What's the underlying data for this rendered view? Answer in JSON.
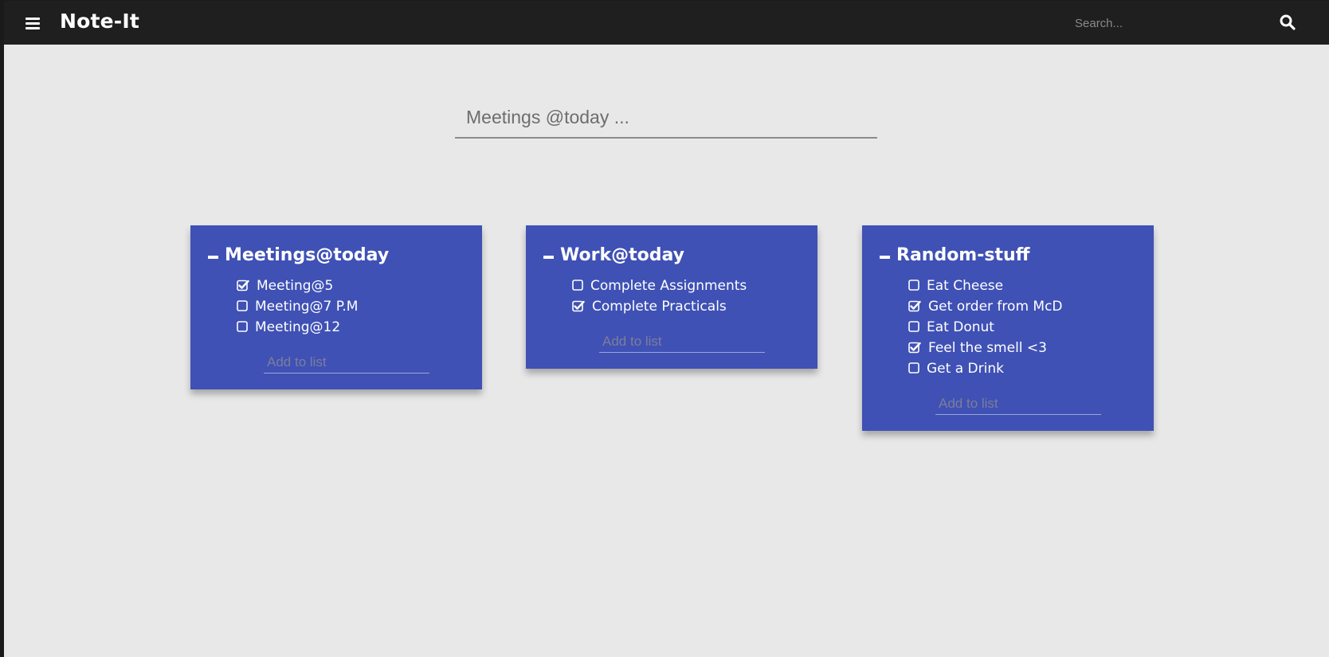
{
  "app": {
    "title": "Note-It"
  },
  "header": {
    "menu_icon": "hamburger-menu-icon",
    "search_placeholder": "Search...",
    "search_icon": "search-icon"
  },
  "new_list": {
    "placeholder": "Meetings @today ..."
  },
  "colors": {
    "card": "#3f51b5",
    "topbar": "#1f1f1f",
    "background": "#e8e8e8"
  },
  "cards": [
    {
      "title": "Meetings@today",
      "add_placeholder": "Add to list",
      "items": [
        {
          "label": "Meeting@5",
          "checked": true
        },
        {
          "label": "Meeting@7 P.M",
          "checked": false
        },
        {
          "label": "Meeting@12",
          "checked": false
        }
      ]
    },
    {
      "title": "Work@today",
      "add_placeholder": "Add to list",
      "items": [
        {
          "label": "Complete Assignments",
          "checked": false
        },
        {
          "label": "Complete Practicals",
          "checked": true
        }
      ]
    },
    {
      "title": "Random-stuff",
      "add_placeholder": "Add to list",
      "items": [
        {
          "label": "Eat Cheese",
          "checked": false
        },
        {
          "label": "Get order from McD",
          "checked": true
        },
        {
          "label": "Eat Donut",
          "checked": false
        },
        {
          "label": "Feel the smell <3",
          "checked": true
        },
        {
          "label": "Get a Drink",
          "checked": false
        }
      ]
    }
  ]
}
